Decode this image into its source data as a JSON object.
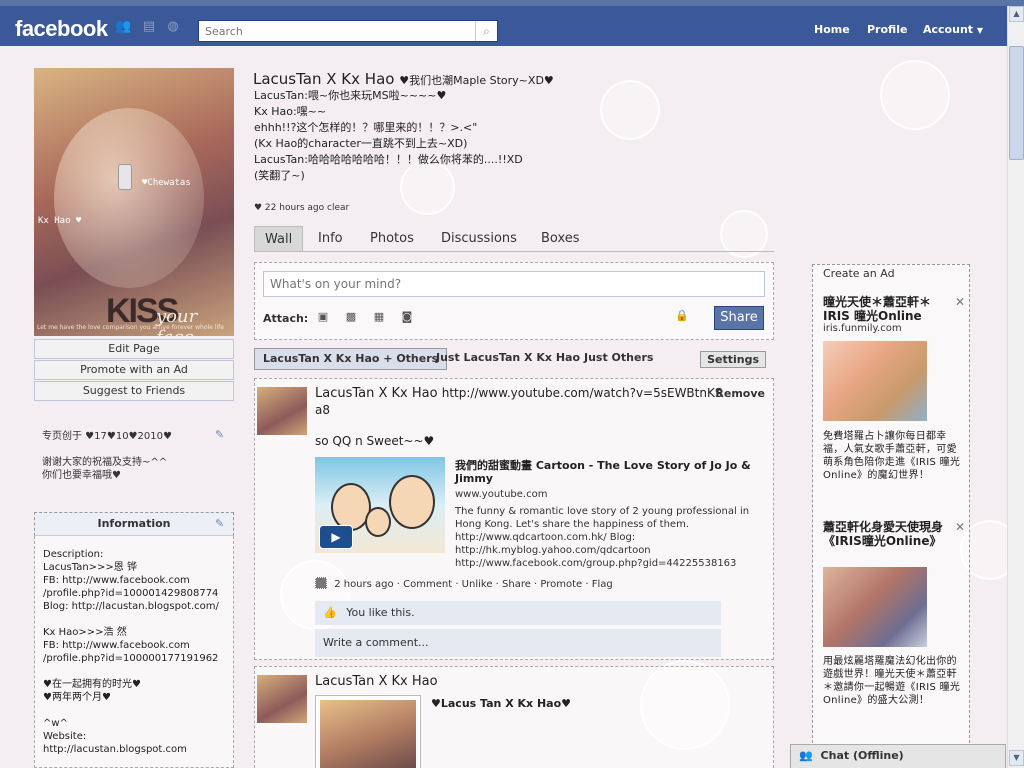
{
  "app": {
    "logo": "facebook"
  },
  "header": {
    "search_placeholder": "Search",
    "nav": {
      "home": "Home",
      "profile": "Profile",
      "account": "Account"
    }
  },
  "left": {
    "photo": {
      "tag_name": "♥Chewatas",
      "tag_kx": "Kx Hao ♥",
      "kiss": "KISS",
      "your_face": "your face",
      "caption": "Let me have the love comparison you arrive forever whole life"
    },
    "buttons": {
      "edit": "Edit Page",
      "promote": "Promote with an Ad",
      "suggest": "Suggest to Friends"
    },
    "bio": "专页创于 ♥17♥10♥2010♥\n\n谢谢大家的祝福及支持~^^\n你们也要幸福哦♥",
    "info_heading": "Information",
    "info_text": "Description:\nLacusTan>>>恩 铧\nFB: http://www.facebook.com\n/profile.php?id=100001429808774\nBlog: http://lacustan.blogspot.com/\n\nKx Hao>>>浩 然\nFB: http://www.facebook.com\n/profile.php?id=100000177191962\n\n♥在一起拥有的时光♥\n♥两年两个月♥\n\n^w^\nWebsite:\nhttp://lacustan.blogspot.com"
  },
  "profile": {
    "name": "LacusTan X Kx Hao",
    "status_inline": "♥我们也潮Maple Story~XD♥",
    "status_lines": "LacusTan:喂~你也来玩MS啦~~~~♥\nKx Hao:嘿~~\nehhh!!?这个怎样的！？哪里来的！！？>.<\"\n(Kx Hao的character一直跳不到上去~XD)\nLacusTan:哈哈哈哈哈哈哈！！！做么你将苯的....!!XD\n(笑翻了~)",
    "status_meta": "♥ 22 hours ago clear"
  },
  "tabs": [
    "Wall",
    "Info",
    "Photos",
    "Discussions",
    "Boxes"
  ],
  "publisher": {
    "placeholder": "What's on your mind?",
    "attach_label": "Attach:",
    "share": "Share"
  },
  "filters": {
    "active": "LacusTan X Kx Hao + Others",
    "just_page": "Just LacusTan X Kx Hao",
    "just_others": "Just Others",
    "settings": "Settings"
  },
  "stories": [
    {
      "author": "LacusTan X Kx Hao",
      "url_part1": "http://www.youtube.com/watch?v=5sEWBtnKS",
      "url_part2": "a8",
      "remove": "Remove",
      "message": "so QQ n Sweet~~♥",
      "attachment": {
        "title": "我們的甜蜜動畫 Cartoon - The Love Story of Jo Jo & Jimmy",
        "domain": "www.youtube.com",
        "description": "The funny & romantic love story of 2 young professional in Hong Kong. Let's share the happiness of them. http://www.qdcartoon.com.hk/ Blog: http://hk.myblog.yahoo.com/qdcartoon http://www.facebook.com/group.php?gid=44225538163"
      },
      "meta": "2 hours ago · Comment · Unlike · Share · Promote · Flag",
      "likes": "You like this.",
      "comment_placeholder": "Write a comment..."
    },
    {
      "author": "LacusTan X Kx Hao",
      "caption": "♥Lacus Tan X Kx Hao♥"
    }
  ],
  "ads": {
    "create": "Create an Ad",
    "items": [
      {
        "title": "曈光天使＊蕭亞軒＊IRIS 曈光Online",
        "domain": "iris.funmily.com",
        "text": "免費塔羅占卜讓你每日都幸福，人氣女歌手蕭亞軒，可愛萌系角色陪你走進《IRIS 曈光Online》的魔幻世界！"
      },
      {
        "title": "蕭亞軒化身愛天使現身《IRIS曈光Online》",
        "text": "用最炫麗塔羅魔法幻化出你的遊戲世界！曈光天使＊蕭亞軒＊邀請你一起暢遊《IRIS 曈光Online》的盛大公測！"
      }
    ]
  },
  "chat": {
    "label": "Chat (Offline)"
  }
}
